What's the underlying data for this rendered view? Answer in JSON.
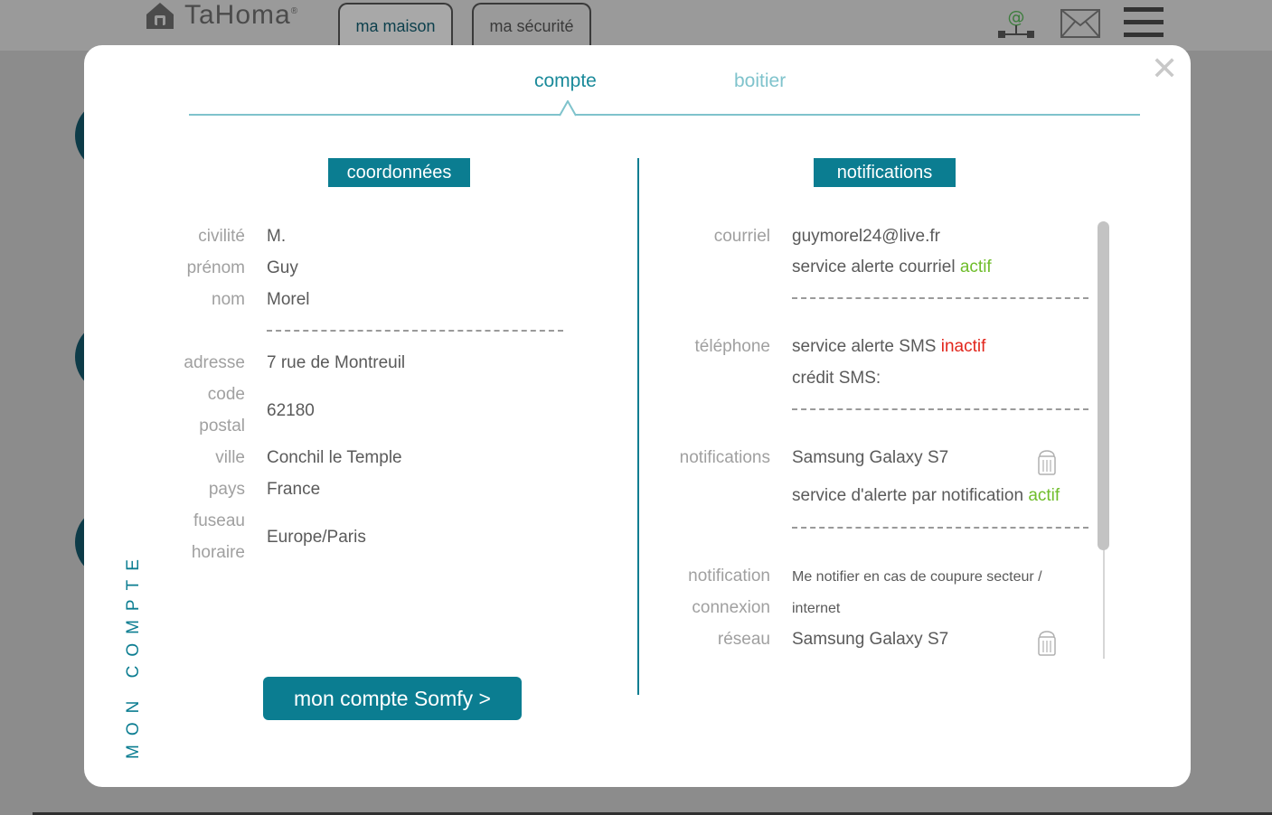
{
  "app": {
    "logo": "TaHoma",
    "logo_mark": "®",
    "tabs": [
      {
        "label": "ma maison",
        "active": true
      },
      {
        "label": "ma sécurité",
        "active": false
      }
    ],
    "icons": [
      "network-at-icon",
      "mail-icon",
      "menu-icon"
    ]
  },
  "modal": {
    "tabs": {
      "compte": "compte",
      "boitier": "boitier"
    },
    "side_title": "MON COMPTE",
    "close_glyph": "✕"
  },
  "coordonnees": {
    "title": "coordonnées",
    "civilite_label": "civilité",
    "civilite": "M.",
    "prenom_label": "prénom",
    "prenom": "Guy",
    "nom_label": "nom",
    "nom": "Morel",
    "adresse_label": "adresse",
    "adresse": "7 rue de Montreuil",
    "code_label_1": "code",
    "code_label_2": "postal",
    "code": "62180",
    "ville_label": "ville",
    "ville": "Conchil le Temple",
    "pays_label": "pays",
    "pays": "France",
    "fuseau_label_1": "fuseau",
    "fuseau_label_2": "horaire",
    "fuseau": "Europe/Paris",
    "button": "mon compte Somfy >"
  },
  "notifications": {
    "title": "notifications",
    "courriel_label": "courriel",
    "email": "guymorel24@live.fr",
    "email_service": "service alerte courriel",
    "email_status": "actif",
    "telephone_label": "téléphone",
    "sms_service": "service alerte SMS",
    "sms_status": "inactif",
    "sms_credit": "crédit SMS:",
    "notif_label": "notifications",
    "device": "Samsung Galaxy S7",
    "notif_service": "service d'alerte par notification",
    "notif_status": "actif",
    "net_label_1": "notification",
    "net_label_2": "connexion",
    "net_label_3": "réseau",
    "net_text_1": "Me notifier en cas de coupure secteur /",
    "net_text_2": "internet",
    "net_device": "Samsung Galaxy S7"
  },
  "colors": {
    "accent": "#0b7d91",
    "active": "#6fbd2b",
    "inactive": "#e2261c"
  }
}
